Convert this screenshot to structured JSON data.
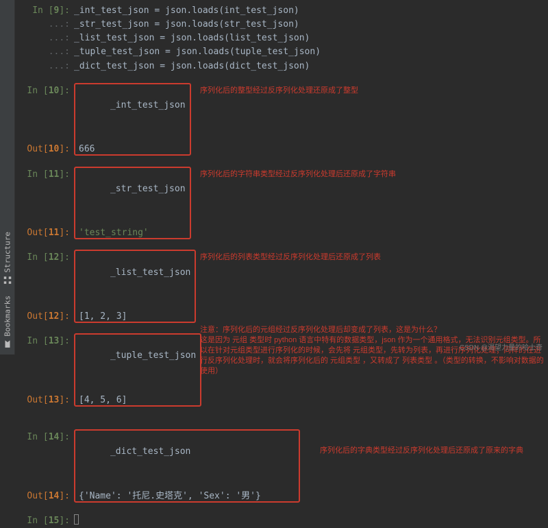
{
  "sidebar": {
    "tabs": [
      {
        "label": "Structure",
        "icon": "structure-icon"
      },
      {
        "label": "Bookmarks",
        "icon": "bookmarks-icon"
      }
    ]
  },
  "block9": {
    "num": "9",
    "lines": [
      "_int_test_json = json.loads(int_test_json)",
      "_str_test_json = json.loads(str_test_json)",
      "_list_test_json = json.loads(list_test_json)",
      "_tuple_test_json = json.loads(tuple_test_json)",
      "_dict_test_json = json.loads(dict_test_json)"
    ],
    "cont": "...:"
  },
  "cell10": {
    "num": "10",
    "in": "_int_test_json",
    "out": "666",
    "annot": "序列化后的整型经过反序列化处理还原成了整型"
  },
  "cell11": {
    "num": "11",
    "in": "_str_test_json",
    "out": "'test_string'",
    "annot": "序列化后的字符串类型经过反序列化处理后还原成了字符串"
  },
  "cell12": {
    "num": "12",
    "in": "_list_test_json",
    "out": "[1, 2, 3]",
    "annot": "序列化后的列表类型经过反序列化处理后还原成了列表"
  },
  "cell13": {
    "num": "13",
    "in": "_tuple_test_json",
    "out": "[4, 5, 6]",
    "annot": "注意：序列化后的元组经过反序列化处理后却变成了列表，这是为什么？\n这是因为 元组 类型时 python 语言中特有的数据类型，json 作为一个通用格式，无法识别元组类型。所以在针对元组类型进行序列化的时候，会先将 元组类型，先转为列表，再进行序列化处理；同样的在进行反序列化处理时，就会将序列化后的 元组类型 ，又转成了 列表类型 。（类型的转换，不影响对数据的使用）"
  },
  "cell14": {
    "num": "14",
    "in": "_dict_test_json",
    "out": "{'Name': '托尼.史塔克', 'Sex': '男'}",
    "annot": "序列化后的字典类型经过反序列化处理后还原成了原来的字典"
  },
  "cell15": {
    "num": "15"
  },
  "labels": {
    "in": "In",
    "out": "Out"
  },
  "watermark": "CSDN @渴望力量的哈士奇"
}
